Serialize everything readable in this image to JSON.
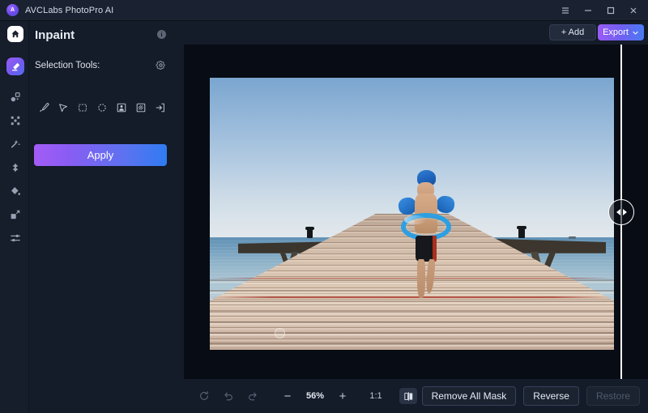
{
  "titlebar": {
    "app_name": "AVCLabs PhotoPro AI",
    "logo_text": "A",
    "menu_icon": "hamburger-menu-icon",
    "minimize_icon": "minimize-icon",
    "maximize_icon": "maximize-icon",
    "close_icon": "close-icon"
  },
  "rail": {
    "home_icon": "home-icon",
    "items": [
      {
        "icon": "eraser-inpaint-icon",
        "active": true
      },
      {
        "icon": "object-remove-icon",
        "active": false
      },
      {
        "icon": "background-remove-icon",
        "active": false
      },
      {
        "icon": "magic-wand-icon",
        "active": false
      },
      {
        "icon": "enhance-sparkle-icon",
        "active": false
      },
      {
        "icon": "colorize-drop-icon",
        "active": false
      },
      {
        "icon": "upscale-resize-icon",
        "active": false
      },
      {
        "icon": "adjust-sliders-icon",
        "active": false
      }
    ]
  },
  "panel": {
    "title": "Inpaint",
    "info_icon": "info-icon",
    "section_label": "Selection Tools:",
    "gear_icon": "gear-icon",
    "tools": [
      {
        "icon": "brush-icon"
      },
      {
        "icon": "lasso-pointer-icon"
      },
      {
        "icon": "rectangle-select-icon"
      },
      {
        "icon": "ellipse-select-icon"
      },
      {
        "icon": "person-select-icon"
      },
      {
        "icon": "texture-select-icon"
      },
      {
        "icon": "import-selection-icon"
      }
    ],
    "apply_label": "Apply"
  },
  "topbar": {
    "add_label": "+ Add",
    "export_label": "Export",
    "export_caret_icon": "chevron-down-icon"
  },
  "canvas": {
    "compare_slider": {
      "position_percent": 94,
      "left_arrow_icon": "triangle-left-icon",
      "right_arrow_icon": "triangle-right-icon"
    },
    "photo": {
      "description": "Child wearing a blue swim cap, blue arm floats and a blue inflatable swim ring walking away along a weathered wooden pier toward calm blue sea under a clear pale sky",
      "watermark_icon": "watermark-icon"
    }
  },
  "bottombar": {
    "reset_icon": "reset-rotate-icon",
    "undo_icon": "undo-icon",
    "redo_icon": "redo-icon",
    "zoom_out_label": "−",
    "zoom_level": "56%",
    "zoom_in_label": "+",
    "fit_ratio_label": "1:1",
    "compare_icon": "split-compare-icon",
    "remove_all_mask_label": "Remove All Mask",
    "reverse_label": "Reverse",
    "restore_label": "Restore"
  },
  "colors": {
    "accent_purple": "#9a5cf5",
    "accent_blue": "#4a7af2",
    "panel_bg": "#141b29",
    "rail_bg": "#161d2b",
    "canvas_bg": "#080c14",
    "titlebar_bg": "#1a2130"
  }
}
